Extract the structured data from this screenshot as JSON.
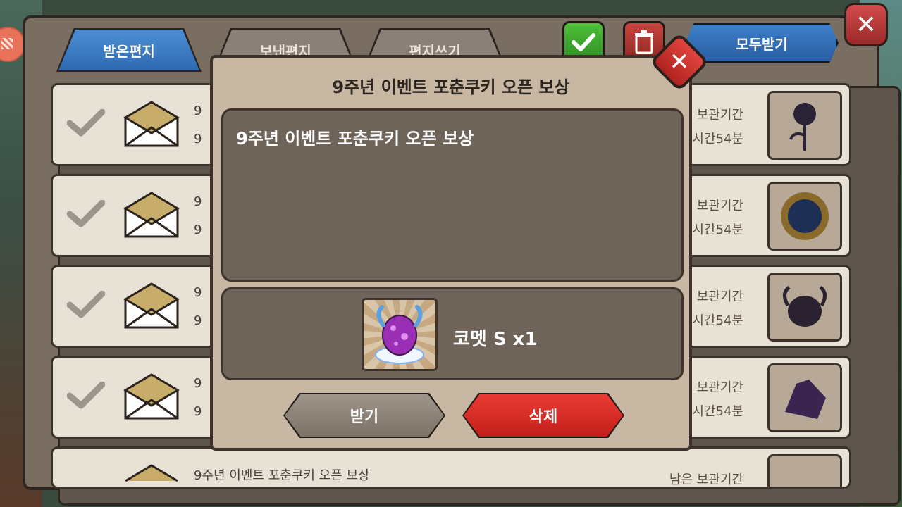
{
  "tabs": [
    {
      "label": "받은편지"
    },
    {
      "label": "보낸편지"
    },
    {
      "label": "편지쓰기"
    }
  ],
  "toolbar": {
    "receive_all_label": "모두받기",
    "check_icon": "check-icon",
    "trash_icon": "trash-icon",
    "close_icon": "close-icon"
  },
  "mail_rows": [
    {
      "frag1": "9",
      "frag2": "9",
      "expiry1": "보관기간",
      "expiry2": "시간54분",
      "item_icon": "black-rose-icon"
    },
    {
      "frag1": "9",
      "frag2": "9",
      "expiry1": "보관기간",
      "expiry2": "시간54분",
      "item_icon": "mirror-icon"
    },
    {
      "frag1": "9",
      "frag2": "9",
      "expiry1": "보관기간",
      "expiry2": "시간54분",
      "item_icon": "horned-creature-icon"
    },
    {
      "frag1": "9",
      "frag2": "9",
      "expiry1": "보관기간",
      "expiry2": "시간54분",
      "item_icon": "crystal-icon"
    },
    {
      "frag1": "9주년 이벤트 포춘쿠키 오픈 보상",
      "frag2": "",
      "expiry1": "남은 보관기간",
      "expiry2": "",
      "item_icon": "item-icon"
    }
  ],
  "modal": {
    "title": "9주년 이벤트 포춘쿠키 오픈 보상",
    "body": "9주년 이벤트 포춘쿠키 오픈 보상",
    "reward_label": "코멧 S x1",
    "reward_icon": "comet-egg-icon",
    "receive_label": "받기",
    "delete_label": "삭제"
  },
  "colors": {
    "active_tab": "#2e69b0",
    "delete_button": "#c21f1a",
    "receive_button": "#7c7268"
  }
}
